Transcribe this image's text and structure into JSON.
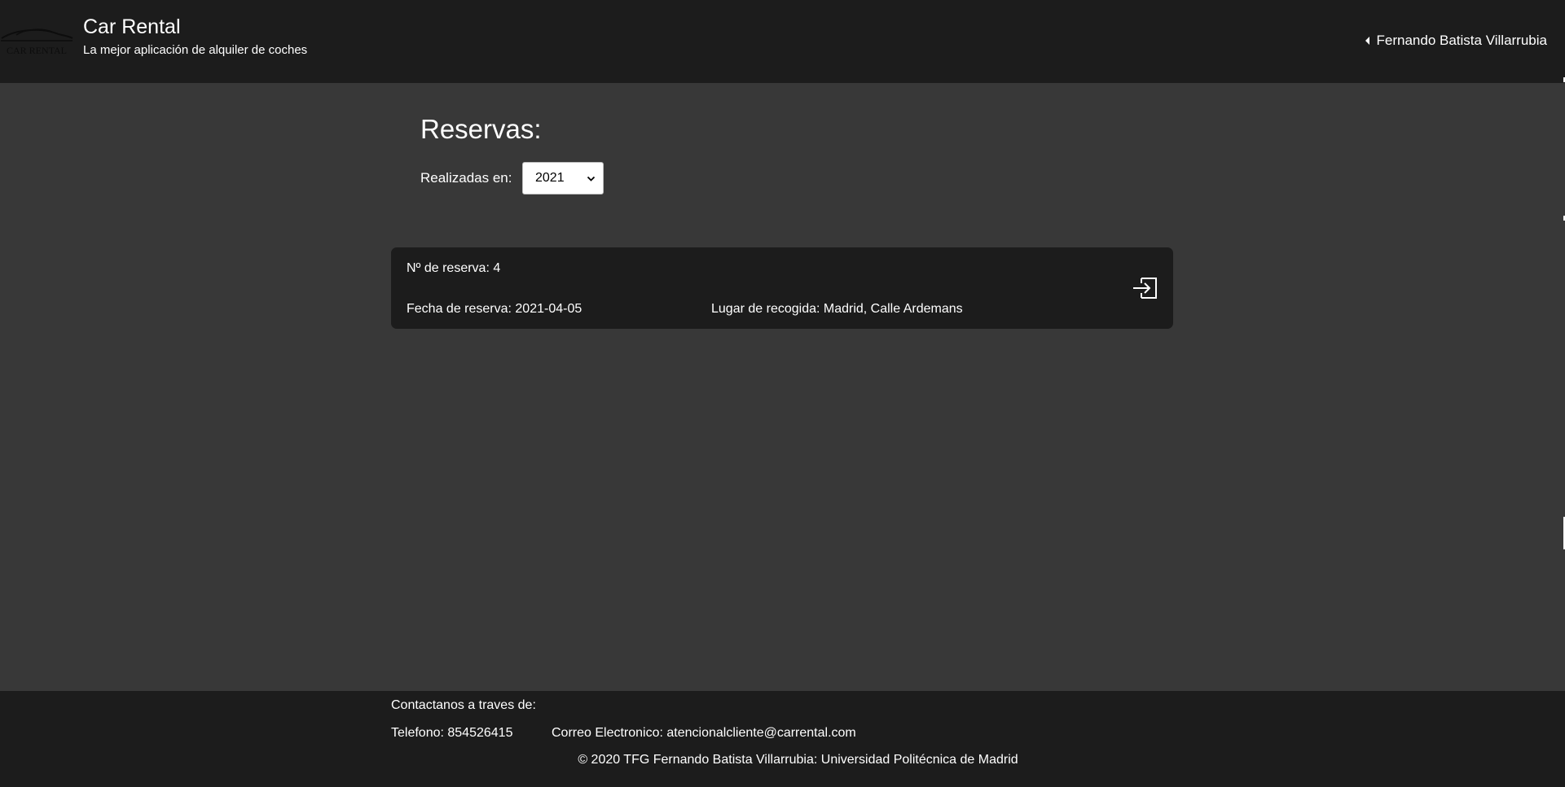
{
  "header": {
    "logo_text": "CAR RENTAL",
    "title": "Car Rental",
    "subtitle": "La mejor aplicación de alquiler de coches",
    "user_name": "Fernando Batista Villarrubia",
    "user_menu_icon": "caret-left-icon"
  },
  "main": {
    "page_title": "Reservas:",
    "filter_label": "Realizadas en:",
    "year_select": {
      "value": "2021",
      "icon": "chevron-down-icon"
    },
    "bookings": [
      {
        "number_text": "Nº de reserva: 4",
        "date_text": "Fecha de reserva: 2021-04-05",
        "place_text": "Lugar de recogida: Madrid, Calle Ardemans",
        "action_icon": "enter-icon"
      }
    ]
  },
  "footer": {
    "contact_title": "Contactanos a traves de:",
    "phone_text": "Telefono: 854526415",
    "email_text": "Correo Electronico: atencionalcliente@carrental.com",
    "copyright_text": "© 2020 TFG Fernando Batista Villarrubia: Universidad Politécnica de Madrid"
  },
  "colors": {
    "page_background": "#383838",
    "bar_background": "#1c1c1c",
    "text": "#ffffff"
  }
}
